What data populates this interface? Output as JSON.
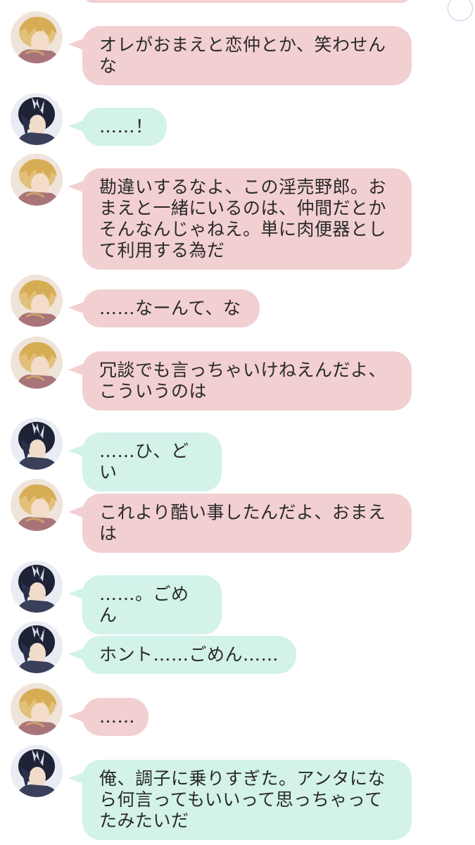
{
  "colors": {
    "pink_bubble": "#f2cfd1",
    "mint_bubble": "#d2f2ea",
    "text": "#2a2a2a"
  },
  "avatars": {
    "blonde": "blonde-character-avatar",
    "dark": "dark-hair-character-avatar"
  },
  "messages": [
    {
      "speaker": "blonde",
      "text": "オレがおまえと恋仲とか、笑わせんな"
    },
    {
      "speaker": "dark",
      "text": "……！"
    },
    {
      "speaker": "blonde",
      "text": "勘違いするなよ、この淫売野郎。おまえと一緒にいるのは、仲間だとかそんなんじゃねえ。単に肉便器として利用する為だ"
    },
    {
      "speaker": "blonde",
      "text": "……なーんて、な"
    },
    {
      "speaker": "blonde",
      "text": "冗談でも言っちゃいけねえんだよ、こういうのは"
    },
    {
      "speaker": "dark",
      "text": "……ひ、どい"
    },
    {
      "speaker": "blonde",
      "text": "これより酷い事したんだよ、おまえは"
    },
    {
      "speaker": "dark",
      "text": "……。ごめん"
    },
    {
      "speaker": "dark",
      "text": "ホント……ごめん……"
    },
    {
      "speaker": "blonde",
      "text": "……"
    },
    {
      "speaker": "dark",
      "text": "俺、調子に乗りすぎた。アンタになら何言ってもいいって思っちゃってたみたいだ"
    }
  ]
}
